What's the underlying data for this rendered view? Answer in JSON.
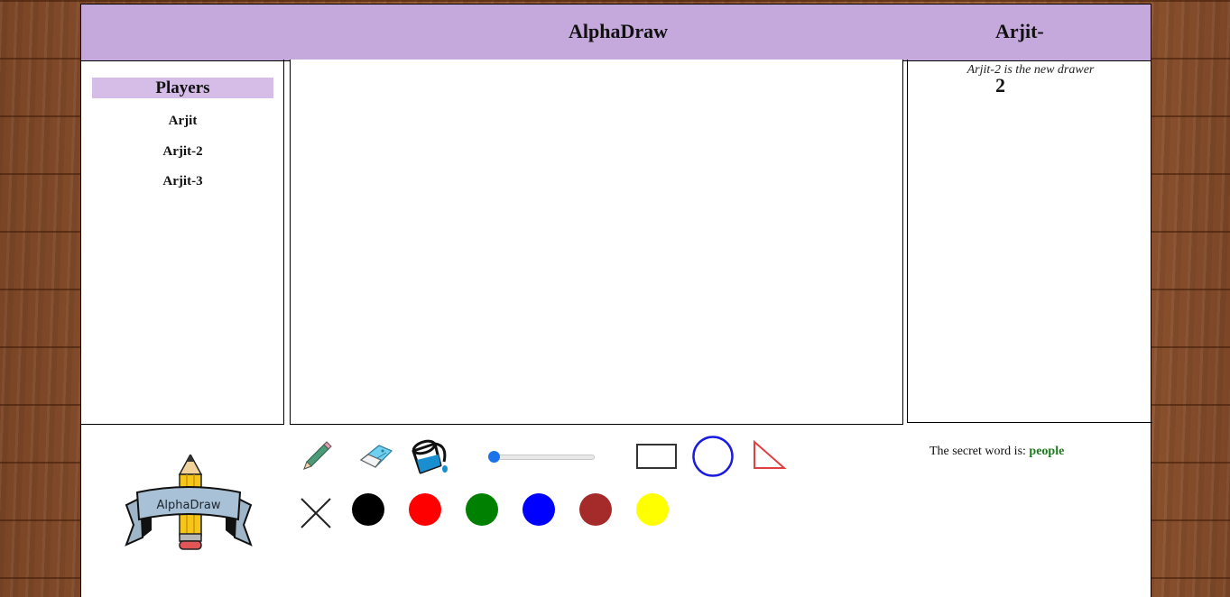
{
  "header": {
    "app_title": "AlphaDraw",
    "drawer_name": "Arjit-2"
  },
  "players": {
    "title": "Players",
    "items": [
      "Arjit",
      "Arjit-2",
      "Arjit-3"
    ]
  },
  "messages": {
    "items": [
      "Arjit-2 is the new drawer"
    ]
  },
  "logo": {
    "text": "AlphaDraw"
  },
  "toolbar": {
    "tools": [
      "pencil-icon",
      "eraser-icon",
      "fill-bucket-icon",
      "rectangle-icon",
      "circle-icon",
      "triangle-icon",
      "clear-icon"
    ],
    "brush_size": 0,
    "colors": [
      "#000000",
      "#ff0000",
      "#008000",
      "#0000ff",
      "#a52a2a",
      "#ffff00"
    ]
  },
  "secret": {
    "label": "The secret word is:",
    "word": "people"
  }
}
